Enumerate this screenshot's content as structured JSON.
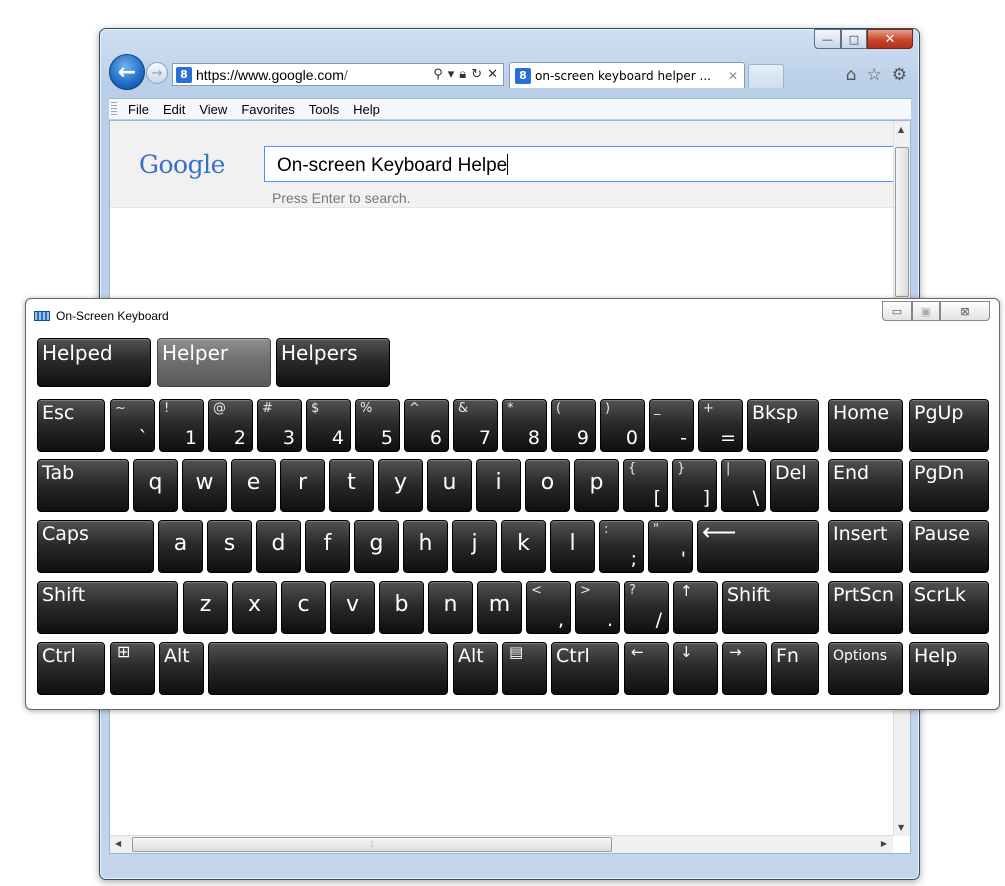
{
  "browser": {
    "address": {
      "scheme": "https://",
      "host": "www.google.com",
      "tail": "/"
    },
    "tab_title": "on-screen keyboard helper ...",
    "window_buttons": {
      "minimize": "—",
      "maximize": "□",
      "close": "✕"
    },
    "menu": [
      "File",
      "Edit",
      "View",
      "Favorites",
      "Tools",
      "Help"
    ],
    "page": {
      "logo": "Google",
      "search_value": "On-screen Keyboard  Helpe",
      "hint": "Press Enter to search."
    }
  },
  "osk": {
    "title": "On-Screen Keyboard",
    "predictions": [
      "Helped",
      "Helper",
      "Helpers"
    ],
    "selected_prediction": 1,
    "keys": {
      "esc": "Esc",
      "tilde_shift": "~",
      "tilde": "`",
      "n1s": "!",
      "n1": "1",
      "n2s": "@",
      "n2": "2",
      "n3s": "#",
      "n3": "3",
      "n4s": "$",
      "n4": "4",
      "n5s": "%",
      "n5": "5",
      "n6s": "^",
      "n6": "6",
      "n7s": "&",
      "n7": "7",
      "n8s": "*",
      "n8": "8",
      "n9s": "(",
      "n9": "9",
      "n0s": ")",
      "n0": "0",
      "minus_s": "_",
      "minus": "-",
      "eq_s": "+",
      "eq": "=",
      "bksp": "Bksp",
      "home": "Home",
      "pgup": "PgUp",
      "tab": "Tab",
      "q": "q",
      "w": "w",
      "e": "e",
      "r": "r",
      "t": "t",
      "y": "y",
      "u": "u",
      "i": "i",
      "o": "o",
      "p": "p",
      "lbr_s": "{",
      "lbr": "[",
      "rbr_s": "}",
      "rbr": "]",
      "bsl_s": "|",
      "bsl": "\\",
      "del": "Del",
      "end": "End",
      "pgdn": "PgDn",
      "caps": "Caps",
      "a": "a",
      "s": "s",
      "d": "d",
      "f": "f",
      "g": "g",
      "h": "h",
      "j": "j",
      "k": "k",
      "l": "l",
      "semi_s": ":",
      "semi": ";",
      "quote_s": "\"",
      "quote": "'",
      "enter": "⟵",
      "insert": "Insert",
      "pause": "Pause",
      "shift": "Shift",
      "z": "z",
      "x": "x",
      "c": "c",
      "v": "v",
      "b": "b",
      "n": "n",
      "m": "m",
      "comma_s": "<",
      "comma": ",",
      "dot_s": ">",
      "dot": ".",
      "slash_s": "?",
      "slash": "/",
      "up": "↑",
      "rshift": "Shift",
      "prtscn": "PrtScn",
      "scrlk": "ScrLk",
      "ctrl": "Ctrl",
      "win": "⊞",
      "alt": "Alt",
      "ralt": "Alt",
      "menu": "▤",
      "rctrl": "Ctrl",
      "left": "←",
      "down": "↓",
      "right": "→",
      "fn": "Fn",
      "options": "Options",
      "help": "Help"
    }
  }
}
